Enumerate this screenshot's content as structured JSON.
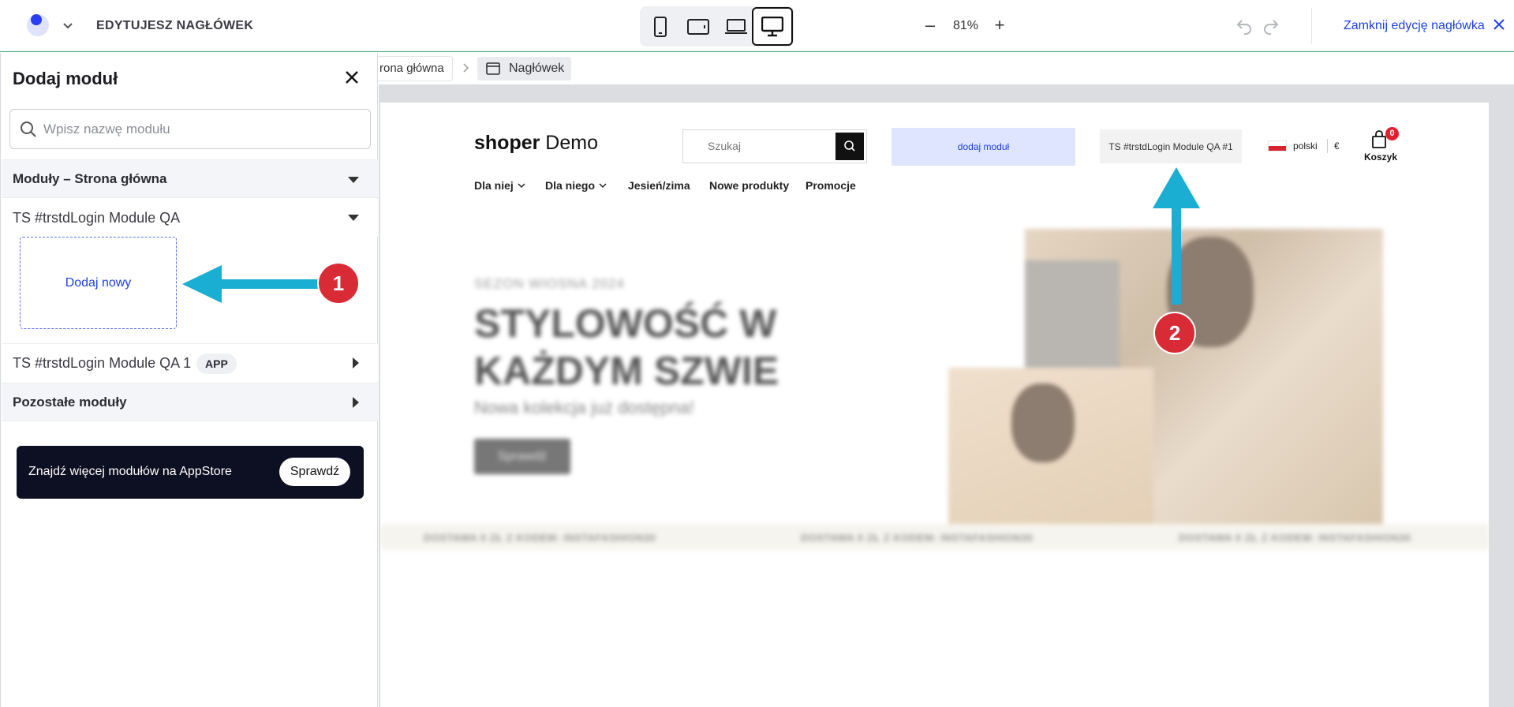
{
  "topbar": {
    "editing_label": "EDYTUJESZ NAGŁÓWEK",
    "zoom": "81%",
    "zoom_minus": "–",
    "zoom_plus": "+",
    "close_edit": "Zamknij edycję nagłówka",
    "devices": [
      "mobile-icon",
      "tablet-icon",
      "laptop-icon",
      "desktop-icon"
    ],
    "active_device": "desktop-icon"
  },
  "sidebar": {
    "title": "Dodaj moduł",
    "search_placeholder": "Wpisz nazwę modułu",
    "group_home": "Moduły – Strona główna",
    "module1": "TS #trstdLogin Module QA",
    "add_new": "Dodaj nowy",
    "module2": "TS #trstdLogin Module QA 1",
    "module2_badge": "APP",
    "group_other": "Pozostałe moduły",
    "appstore_text": "Znajdź więcej modułów na AppStore",
    "appstore_button": "Sprawdź"
  },
  "annotations": {
    "step1": "1",
    "step2": "2",
    "arrow_color": "#1aaed3"
  },
  "breadcrumb": {
    "home": "rona główna",
    "current": "Nagłówek"
  },
  "preview": {
    "logo_bold": "shoper",
    "logo_light": " Demo",
    "search_placeholder": "Szukaj",
    "add_module_slot": "dodaj moduł",
    "login_slot": "TS #trstdLogin Module QA #1",
    "language": "polski",
    "currency": "€",
    "cart_label": "Koszyk",
    "cart_count": "0",
    "nav": [
      "Dla niej",
      "Dla niego",
      "Jesień/zima",
      "Nowe produkty",
      "Promocje"
    ],
    "hero_kicker": "SEZON WIOSNA 2024",
    "hero_title_1": "STYLOWOŚĆ W",
    "hero_title_2": "KAŻDYM SZWIE",
    "hero_sub": "Nowa kolekcja już dostępna!",
    "hero_btn": "Sprawdź",
    "ticker": "DOSTAWA 0 ZŁ Z KODEM: INSTAFASHION30"
  },
  "colors": {
    "accent": "#1f3fe6",
    "badge": "#d92b35",
    "dark_banner": "#0d0f22"
  }
}
